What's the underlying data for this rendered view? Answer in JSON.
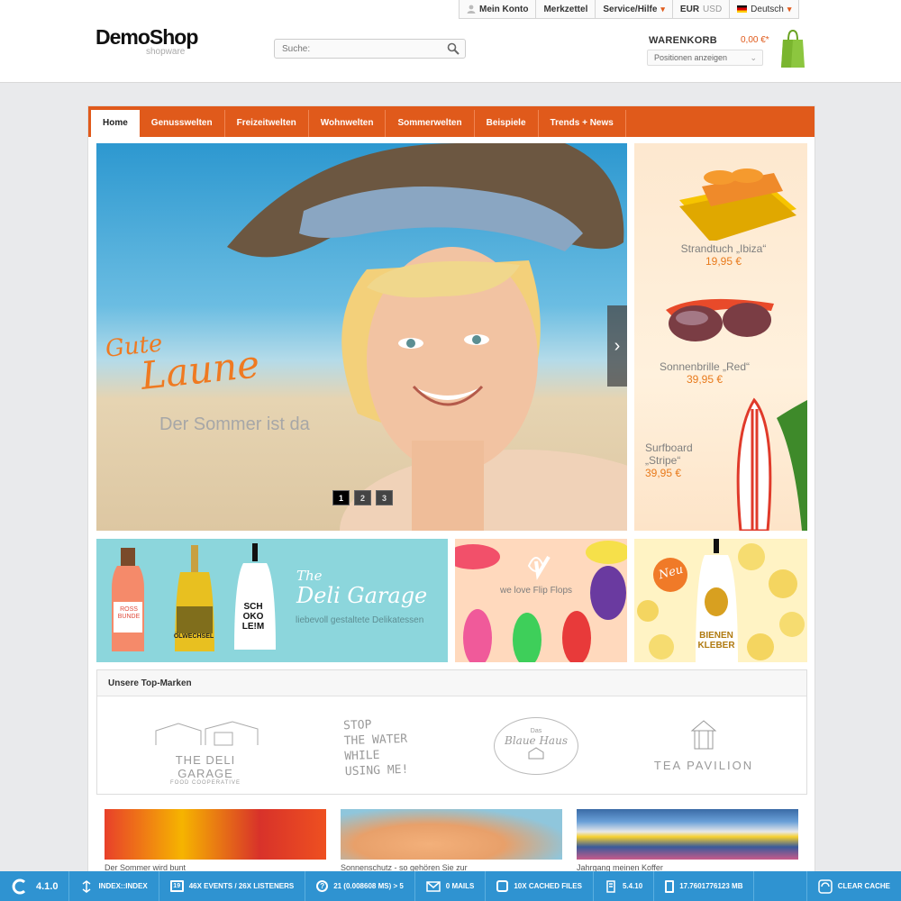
{
  "topbar": {
    "account": "Mein Konto",
    "wishlist": "Merkzettel",
    "service": "Service/Hilfe",
    "currency_active": "EUR",
    "currency_other": "USD",
    "language": "Deutsch"
  },
  "logo": {
    "name": "DemoShop",
    "sub": "shopware"
  },
  "search": {
    "placeholder": "Suche:"
  },
  "cart": {
    "title": "WARENKORB",
    "amount": "0,00 €*",
    "select": "Positionen anzeigen"
  },
  "nav": {
    "items": [
      "Home",
      "Genusswelten",
      "Freizeitwelten",
      "Wohnwelten",
      "Sommerwelten",
      "Beispiele",
      "Trends + News"
    ]
  },
  "hero": {
    "script_line1": "Gute",
    "script_line2": "Laune",
    "subtitle": "Der Sommer ist da",
    "pages": [
      "1",
      "2",
      "3"
    ],
    "active_page": "1"
  },
  "side_products": [
    {
      "name": "Strandtuch „Ibiza“",
      "price": "19,95 €"
    },
    {
      "name": "Sonnenbrille „Red“",
      "price": "39,95 €"
    },
    {
      "name_line1": "Surfboard",
      "name_line2": "„Stripe“",
      "price": "39,95 €"
    }
  ],
  "banners": {
    "deli": {
      "the": "The",
      "title": "Deli Garage",
      "subtitle": "liebevoll gestaltete Delikatessen",
      "bottle1_l1": "ROSS",
      "bottle1_l2": "BUNDE",
      "bottle2": "ÖLWECHSEL",
      "bottle3": [
        "SCH",
        "OKO",
        "LE!M"
      ]
    },
    "flip": {
      "text": "we love Flip Flops"
    },
    "bee": {
      "badge": "Neu",
      "label_l1": "BIENEN",
      "label_l2": "KLEBER"
    }
  },
  "brands": {
    "title": "Unsere Top-Marken",
    "deli_name": "THE DELI GARAGE",
    "deli_coop": "FOOD COOPERATIVE",
    "stop": [
      "STOP",
      "THE WATER",
      "WHILE",
      "USING ME!"
    ],
    "blaue_das": "Das",
    "blaue_name": "Blaue Haus",
    "tea": "TEA PAVILION"
  },
  "teasers": [
    "Der Sommer wird bunt",
    "Sonnenschutz - so gehören Sie zur",
    "Jahrgang meinen Koffer"
  ],
  "debug": {
    "version": "4.1.0",
    "route": "INDEX::INDEX",
    "calendar": "19",
    "events": "46X EVENTS / 26X LISTENERS",
    "queries": "21 (0.008608 MS) > 5",
    "mails": "0 MAILS",
    "cache": "10X CACHED FILES",
    "php": "5.4.10",
    "memory": "17.7601776123 MB",
    "clear": "CLEAR CACHE"
  },
  "colors": {
    "accent": "#e05a1b",
    "debug_bar": "#2f93d1",
    "price": "#e87a1c"
  }
}
